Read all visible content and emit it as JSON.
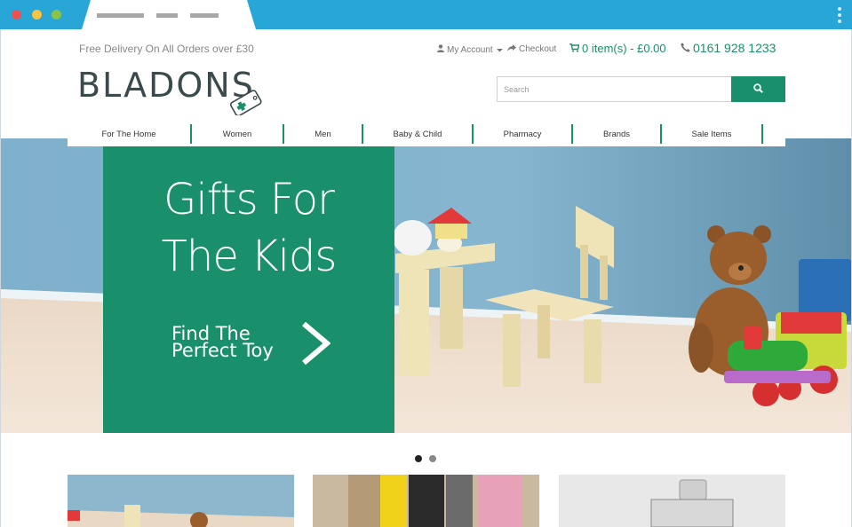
{
  "header": {
    "free_delivery": "Free Delivery On All Orders over £30",
    "my_account": "My Account",
    "checkout": "Checkout",
    "cart": "0 item(s) - £0.00",
    "phone": "0161 928 1233",
    "logo": "BLADONS"
  },
  "search": {
    "placeholder": "Search"
  },
  "nav": {
    "items": [
      {
        "label": "For The Home"
      },
      {
        "label": "Women"
      },
      {
        "label": "Men"
      },
      {
        "label": "Baby & Child"
      },
      {
        "label": "Pharmacy"
      },
      {
        "label": "Brands"
      },
      {
        "label": "Sale Items"
      }
    ]
  },
  "hero": {
    "title_line1": "Gifts For",
    "title_line2": "The Kids",
    "cta_line1": "Find The",
    "cta_line2": "Perfect Toy"
  },
  "carousel": {
    "slides": 2,
    "active": 1
  },
  "colors": {
    "brand": "#1a8f6b",
    "chrome": "#29a6d8"
  },
  "icons": [
    "user-icon",
    "share-icon",
    "cart-icon",
    "phone-icon",
    "search-icon",
    "chevron-right-icon"
  ]
}
